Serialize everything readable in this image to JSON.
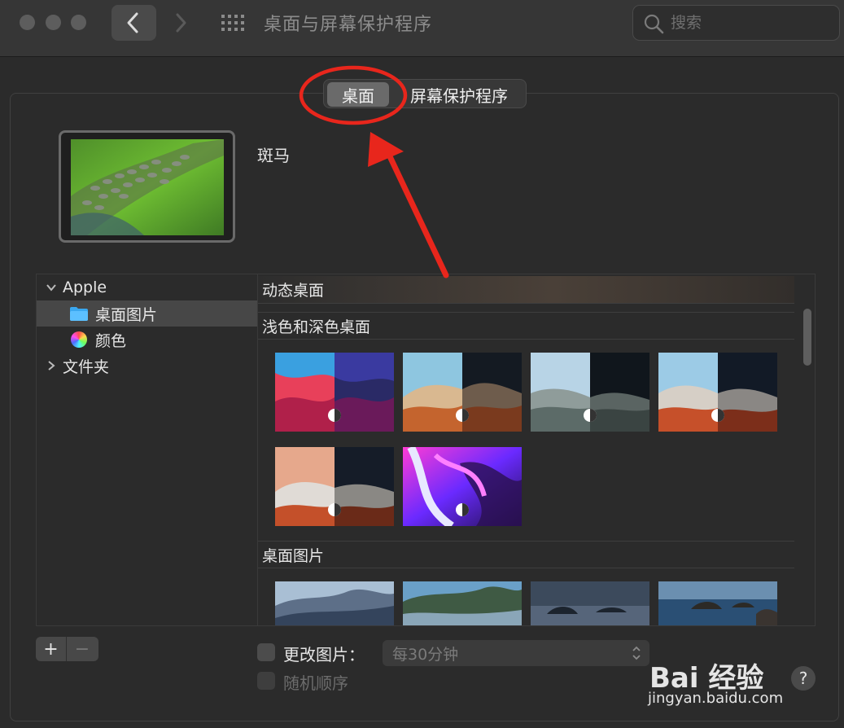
{
  "window": {
    "title": "桌面与屏幕保护程序",
    "search_placeholder": "搜索"
  },
  "tabs": [
    {
      "label": "桌面",
      "selected": true
    },
    {
      "label": "屏幕保护程序",
      "selected": false
    }
  ],
  "preview": {
    "name": "斑马"
  },
  "sidebar": {
    "items": [
      {
        "label": "Apple",
        "expanded": true
      },
      {
        "label": "桌面图片",
        "selected": true
      },
      {
        "label": "颜色"
      },
      {
        "label": "文件夹",
        "expanded": false
      }
    ]
  },
  "browser": {
    "sections": [
      {
        "title": "动态桌面"
      },
      {
        "title": "浅色和深色桌面"
      },
      {
        "title": "桌面图片"
      }
    ]
  },
  "bottom": {
    "add_label": "+",
    "remove_label": "−",
    "change_picture_label": "更改图片：",
    "interval_value": "每30分钟",
    "random_order_label": "随机顺序",
    "help_label": "?"
  },
  "watermark": {
    "brand": "Bai 经验",
    "url": "jingyan.baidu.com"
  },
  "colors": {
    "annotation": "#e8261c",
    "selection": "#474747",
    "folder": "#3aa8f0"
  }
}
